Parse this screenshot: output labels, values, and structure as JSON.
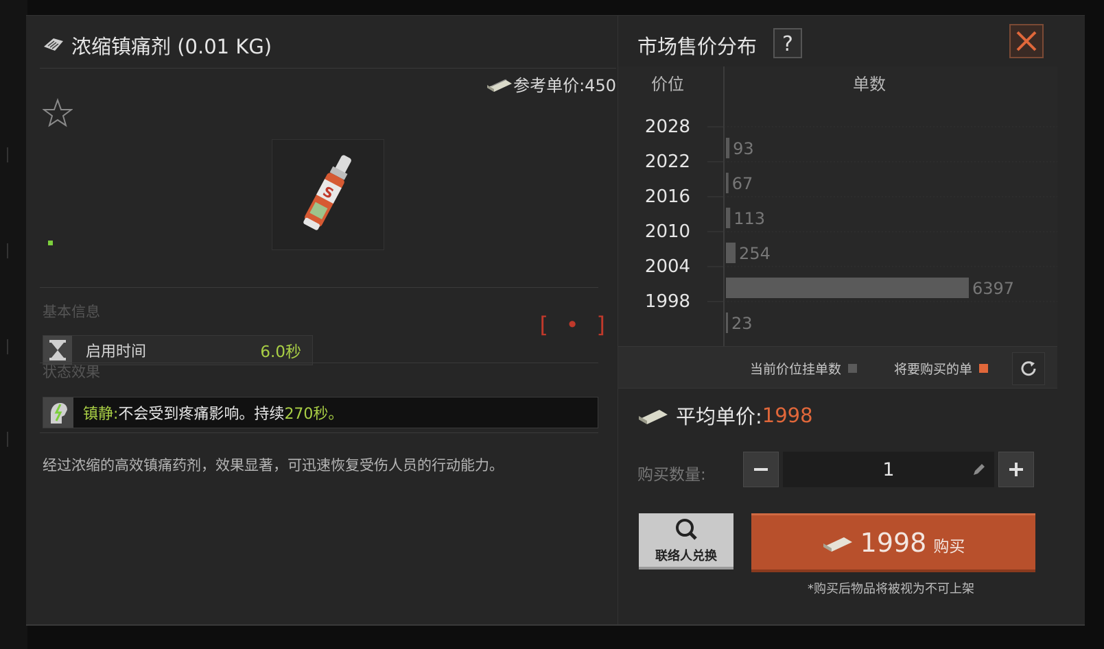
{
  "item": {
    "title": "浓缩镇痛剂 (0.01 KG)",
    "ref_price_label": "参考单价:450",
    "section_basic": "基本信息",
    "stat_label": "启用时间",
    "stat_value": "6.0秒",
    "section_effect": "状态效果",
    "effect_name": "镇静:",
    "effect_text_a": "不会受到疼痛影响。持续",
    "effect_duration": "270秒。",
    "description": "经过浓缩的高效镇痛药剂，效果显著，可迅速恢复受伤人员的行动能力。",
    "bracket_icon": "[ • ]"
  },
  "market": {
    "title": "市场售价分布",
    "help": "?",
    "legend_current": "当前价位挂单数",
    "legend_buy": "将要购买的单",
    "avg_label": "平均单价:",
    "avg_value": "1998",
    "qty_label": "购买数量:",
    "qty_value": "1",
    "contact_label": "联络人兑换",
    "buy_price": "1998",
    "buy_label": "购买",
    "note": "*购买后物品将被视为不可上架"
  },
  "chart_data": {
    "type": "bar",
    "orientation": "horizontal",
    "col_header_price": "价位",
    "col_header_count": "单数",
    "categories": [
      "2028",
      "2022",
      "2016",
      "2010",
      "2004",
      "1998"
    ],
    "values": [
      93,
      67,
      113,
      254,
      6397,
      23
    ],
    "series": [
      {
        "name": "当前价位挂单数",
        "values": [
          93,
          67,
          113,
          254,
          6397,
          23
        ]
      }
    ],
    "colors": {
      "current": "#5a5a5a",
      "buy": "#e0673a"
    },
    "grid": true
  },
  "colors": {
    "accent": "#e0673a",
    "green": "#a9cf45",
    "buy_button": "#b8502c"
  },
  "icons": [
    "tag-icon",
    "cash-icon",
    "star-icon",
    "hourglass-icon",
    "sedation-icon",
    "question-icon",
    "close-icon",
    "refresh-icon",
    "minus-icon",
    "plus-icon",
    "pencil-icon",
    "search-icon"
  ]
}
